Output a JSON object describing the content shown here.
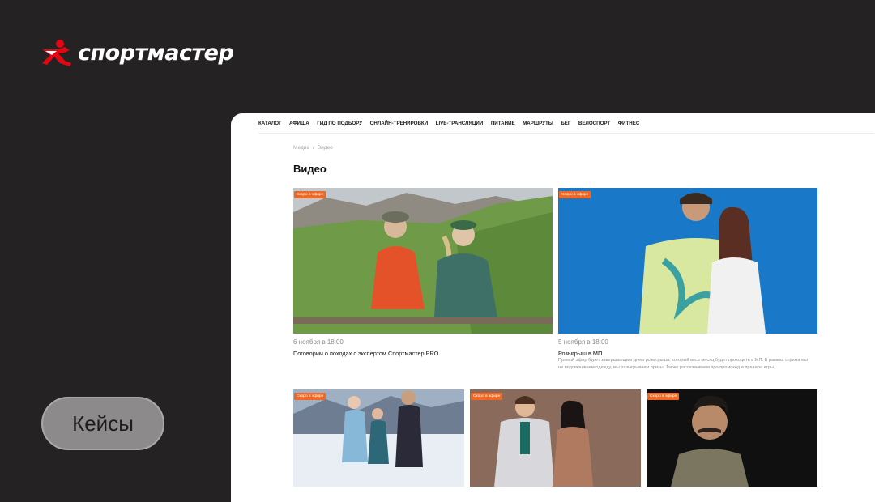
{
  "brand": {
    "name": "спортмастер"
  },
  "cases_button": {
    "label": "Кейсы"
  },
  "nav": {
    "items": [
      "КАТАЛОГ",
      "АФИША",
      "ГИД ПО ПОДБОРУ",
      "ОНЛАЙН-ТРЕНИРОВКИ",
      "LIVE-ТРАНСЛЯЦИИ",
      "ПИТАНИЕ",
      "МАРШРУТЫ",
      "БЕГ",
      "ВЕЛОСПОРТ",
      "ФИТНЕС"
    ]
  },
  "breadcrumb": {
    "parent": "Медиа",
    "separator": "/",
    "current": "Видео"
  },
  "page": {
    "title": "Видео"
  },
  "cards": [
    {
      "badge": "Скоро в эфире",
      "date": "6 ноября в 18:00",
      "title": "Поговорим о походах с экспертом Спортмастер PRO",
      "description": ""
    },
    {
      "badge": "Скоро в эфире",
      "date": "5 ноября в 18:00",
      "title": "Розыгрыш в МП",
      "description": "Прямой эфир будет завершающим днем розыгрыша, который весь месяц будет проходить в МП. В рамках стрима мы не подсвечиваем одежду, мы разыгрываем призы. Также рассказываем про промокод и правила игры."
    },
    {
      "badge": "Скоро в эфире",
      "date": "",
      "title": "",
      "description": ""
    },
    {
      "badge": "Скоро в эфире",
      "date": "",
      "title": "",
      "description": ""
    },
    {
      "badge": "Скоро в эфире",
      "date": "",
      "title": "",
      "description": ""
    }
  ],
  "colors": {
    "accent": "#f26722",
    "background": "#242223",
    "brand_red": "#e30613"
  },
  "icons": {
    "logo": "running-man-logo-icon"
  }
}
